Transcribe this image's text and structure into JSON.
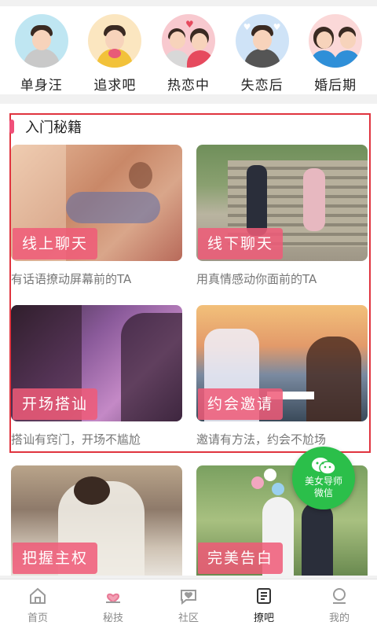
{
  "categories": [
    {
      "label": "单身汪",
      "icon": "single-person-avatar-icon",
      "bg": "#bfe6f2"
    },
    {
      "label": "追求吧",
      "icon": "pursuit-avatar-icon",
      "bg": "#fbe6c0"
    },
    {
      "label": "热恋中",
      "icon": "couple-in-love-avatar-icon",
      "bg": "#f8c9cf"
    },
    {
      "label": "失恋后",
      "icon": "heartbroken-avatar-icon",
      "bg": "#cfe3f7"
    },
    {
      "label": "婚后期",
      "icon": "married-couple-avatar-icon",
      "bg": "#fbd8d8"
    }
  ],
  "section": {
    "title": "入门秘籍",
    "highlight_color": "#e0343f",
    "accent_color": "#f0507a"
  },
  "cards": [
    {
      "tag": "线上聊天",
      "desc": "有话语撩动屏幕前的TA"
    },
    {
      "tag": "线下聊天",
      "desc": "用真情感动你面前的TA"
    },
    {
      "tag": "开场搭讪",
      "desc": "搭讪有窍门，开场不尴尬"
    },
    {
      "tag": "约会邀请",
      "desc": "邀请有方法，约会不尬场"
    },
    {
      "tag": "把握主权",
      "desc": ""
    },
    {
      "tag": "完美告白",
      "desc": ""
    }
  ],
  "wechat_badge": {
    "line1": "美女导师",
    "line2": "微信",
    "color": "#2bbf4a"
  },
  "bottom_nav": [
    {
      "label": "首页",
      "icon": "home-icon"
    },
    {
      "label": "秘技",
      "icon": "heart-hand-icon"
    },
    {
      "label": "社区",
      "icon": "chat-heart-icon"
    },
    {
      "label": "撩吧",
      "icon": "list-icon",
      "active": true
    },
    {
      "label": "我的",
      "icon": "user-icon"
    }
  ]
}
